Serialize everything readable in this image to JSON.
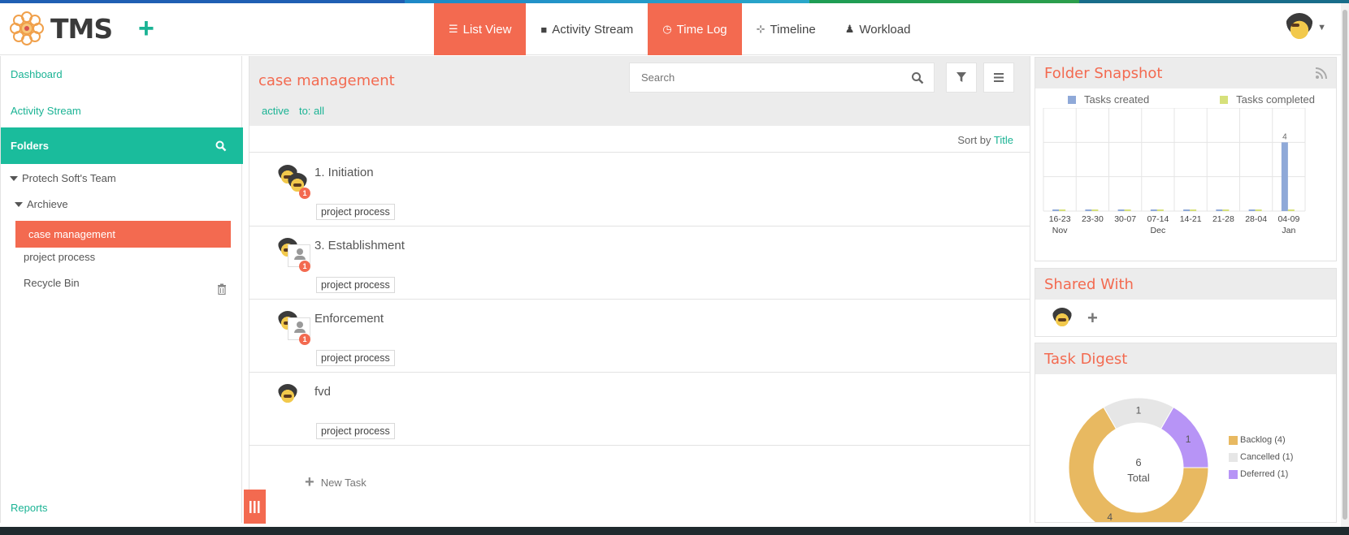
{
  "brand": {
    "name": "TMS",
    "accent": "#f36a50",
    "teal": "#1abc9c"
  },
  "header": {
    "add_icon": "plus-icon",
    "tabs": [
      {
        "label": "List View",
        "icon": "list-icon",
        "active": true
      },
      {
        "label": "Activity Stream",
        "icon": "comment-icon",
        "active": false
      },
      {
        "label": "Time Log",
        "icon": "clock-icon",
        "active": true
      },
      {
        "label": "Timeline",
        "icon": "sliders-icon",
        "active": false
      },
      {
        "label": "Workload",
        "icon": "user-icon",
        "active": false
      }
    ],
    "user_menu_icon": "caret-down-icon"
  },
  "sidebar": {
    "dashboard": "Dashboard",
    "activity_stream": "Activity Stream",
    "folders": "Folders",
    "team": "Protech Soft's Team",
    "archive": "Archieve",
    "selected_folder": "case management",
    "project_process": "project process",
    "recycle_bin": "Recycle Bin",
    "reports": "Reports"
  },
  "main": {
    "folder_title": "case management",
    "search_placeholder": "Search",
    "filter_active": "active",
    "filter_to": "to: all",
    "sort_label": "Sort by",
    "sort_value": "Title",
    "tasks": [
      {
        "title": "1. Initiation",
        "tag": "project process",
        "badge": "1",
        "invitation": false
      },
      {
        "title": "3. Establishment",
        "tag": "project process",
        "badge": "1",
        "invitation": true
      },
      {
        "title": "Enforcement",
        "tag": "project process",
        "badge": "1",
        "invitation": true
      },
      {
        "title": "fvd",
        "tag": "project process",
        "badge": "",
        "invitation": false
      }
    ],
    "new_task": "New Task"
  },
  "snapshot": {
    "title": "Folder Snapshot",
    "legend_created": "Tasks created",
    "legend_completed": "Tasks completed",
    "color_created": "#8fa9d8",
    "color_completed": "#d6e07a"
  },
  "chart_data": [
    {
      "type": "bar",
      "categories": [
        "16-23",
        "23-30",
        "30-07",
        "07-14",
        "14-21",
        "21-28",
        "28-04",
        "04-09"
      ],
      "month_labels": [
        "Nov",
        "",
        "",
        "Dec",
        "",
        "",
        "",
        "Jan"
      ],
      "series": [
        {
          "name": "Tasks created",
          "values": [
            0,
            0,
            0,
            0,
            0,
            0,
            0,
            4
          ]
        },
        {
          "name": "Tasks completed",
          "values": [
            0,
            0,
            0,
            0,
            0,
            0,
            0,
            0
          ]
        }
      ],
      "data_labels": [
        "",
        "",
        "",
        "",
        "",
        "",
        "",
        "4"
      ],
      "ylim": [
        0,
        6
      ],
      "grid": true
    },
    {
      "type": "pie",
      "donut": true,
      "center_value": "6",
      "center_label": "Total",
      "slices": [
        {
          "name": "Backlog (4)",
          "value": 4,
          "color": "#e8b961"
        },
        {
          "name": "Cancelled (1)",
          "value": 1,
          "color": "#e6e6e6"
        },
        {
          "name": "Deferred (1)",
          "value": 1,
          "color": "#b794f6"
        }
      ],
      "slice_labels": [
        "4",
        "1",
        "1"
      ]
    }
  ],
  "shared": {
    "title": "Shared With",
    "add_icon": "plus-icon"
  },
  "digest": {
    "title": "Task Digest"
  }
}
